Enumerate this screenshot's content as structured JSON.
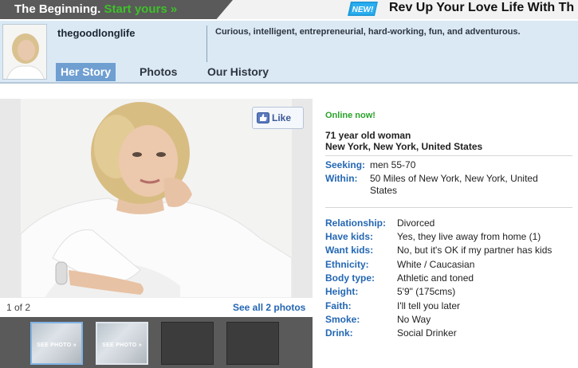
{
  "banner": {
    "left_text": "The Beginning.",
    "left_cta": "Start yours »",
    "new_badge": "NEW!",
    "right_text": "Rev Up Your Love Life With Th"
  },
  "profile": {
    "username": "thegoodlonglife",
    "tagline": "Curious, intelligent, entrepreneurial, hard-working, fun, and adventurous."
  },
  "tabs": [
    {
      "label": "Her Story",
      "active": true
    },
    {
      "label": "Photos",
      "active": false
    },
    {
      "label": "Our History",
      "active": false
    }
  ],
  "photos": {
    "like_label": "Like",
    "count_text": "1 of 2",
    "see_all_label": "See all 2 photos",
    "thumb_label": "SEE PHOTO »"
  },
  "details": {
    "status": "Online now!",
    "age_line": "71 year old woman",
    "location": "New York, New York, United States",
    "seeking_label": "Seeking:",
    "seeking_value": "men 55-70",
    "within_label": "Within:",
    "within_value": "50 Miles of New York, New York, United States",
    "attributes": [
      {
        "label": "Relationship:",
        "value": "Divorced"
      },
      {
        "label": "Have kids:",
        "value": "Yes, they live away from home (1)"
      },
      {
        "label": "Want kids:",
        "value": "No, but it's OK if my partner has kids"
      },
      {
        "label": "Ethnicity:",
        "value": "White / Caucasian"
      },
      {
        "label": "Body type:",
        "value": "Athletic and toned"
      },
      {
        "label": "Height:",
        "value": "5'9\" (175cms)"
      },
      {
        "label": "Faith:",
        "value": "I'll tell you later"
      },
      {
        "label": "Smoke:",
        "value": "No Way"
      },
      {
        "label": "Drink:",
        "value": "Social Drinker"
      }
    ]
  },
  "colors": {
    "accent_green": "#3ec02a",
    "link_blue": "#2467b3",
    "header_bg": "#dbe9f5",
    "active_tab": "#6f9ed1",
    "online_green": "#2aa22a"
  }
}
